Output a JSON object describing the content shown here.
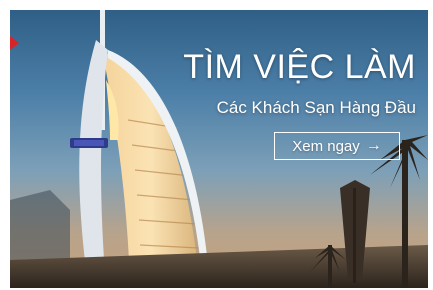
{
  "banner": {
    "title": "TÌM VIỆC LÀM",
    "subtitle": "Các Khách Sạn Hàng Đầu",
    "cta_label": "Xem ngay",
    "cta_icon": "→",
    "image_subject": "burj-al-arab-hotel-photo",
    "accent_color": "#d8232a",
    "sky_color_top": "#2f5f86",
    "sky_color_bottom": "#c9a27a"
  }
}
